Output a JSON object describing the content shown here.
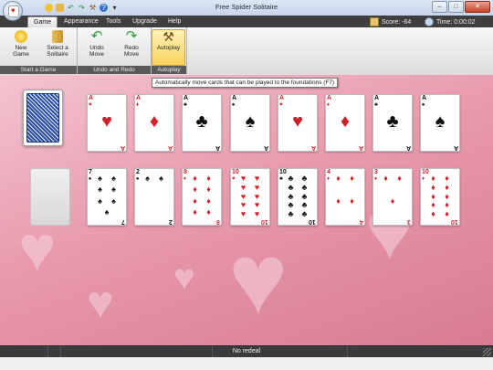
{
  "window": {
    "title": "Free Spider Solitaire",
    "buttons": {
      "minimize": "–",
      "maximize": "□",
      "close": "✕"
    }
  },
  "quick_access": {
    "icons": [
      "coin-icon",
      "deck-icon",
      "undo-icon",
      "redo-icon",
      "autoplay-icon",
      "help-icon"
    ],
    "dropdown": "▾"
  },
  "tabs": [
    {
      "label": "Game",
      "active": true
    },
    {
      "label": "Appearance"
    },
    {
      "label": "Tools"
    },
    {
      "label": "Upgrade"
    },
    {
      "label": "Help"
    }
  ],
  "score": {
    "label": "Score: -64"
  },
  "timer": {
    "label": "Time: 0:00:02"
  },
  "ribbon": {
    "groups": [
      {
        "label": "Start a Game",
        "buttons": [
          {
            "label1": "New",
            "label2": "Game"
          },
          {
            "label1": "Select a",
            "label2": "Solitaire"
          }
        ]
      },
      {
        "label": "Undo and Redo",
        "buttons": [
          {
            "label1": "Undo",
            "label2": "Move"
          },
          {
            "label1": "Redo",
            "label2": "Move"
          }
        ]
      },
      {
        "label": "Autoplay",
        "buttons": [
          {
            "label1": "Autoplay",
            "label2": ""
          }
        ]
      }
    ]
  },
  "tooltip": "Automatically move cards that can be played to the foundations (F7)",
  "foundations": [
    {
      "rank": "A",
      "suit": "♥",
      "color": "red"
    },
    {
      "rank": "A",
      "suit": "♦",
      "color": "red"
    },
    {
      "rank": "A",
      "suit": "♣",
      "color": "black"
    },
    {
      "rank": "A",
      "suit": "♠",
      "color": "black"
    },
    {
      "rank": "A",
      "suit": "♥",
      "color": "red"
    },
    {
      "rank": "A",
      "suit": "♦",
      "color": "red"
    },
    {
      "rank": "A",
      "suit": "♣",
      "color": "black"
    },
    {
      "rank": "A",
      "suit": "♠",
      "color": "black"
    }
  ],
  "tableau": [
    {
      "rank": "7",
      "suit": "♠",
      "color": "black",
      "pips": 7
    },
    {
      "rank": "2",
      "suit": "♠",
      "color": "black",
      "pips": 2
    },
    {
      "rank": "8",
      "suit": "♦",
      "color": "red",
      "pips": 8
    },
    {
      "rank": "10",
      "suit": "♥",
      "color": "red",
      "pips": 10
    },
    {
      "rank": "10",
      "suit": "♣",
      "color": "black",
      "pips": 10
    },
    {
      "rank": "4",
      "suit": "♦",
      "color": "red",
      "pips": 4
    },
    {
      "rank": "3",
      "suit": "♦",
      "color": "red",
      "pips": 3
    },
    {
      "rank": "10",
      "suit": "♦",
      "color": "red",
      "pips": 10
    }
  ],
  "status": {
    "text": "No redeal"
  }
}
